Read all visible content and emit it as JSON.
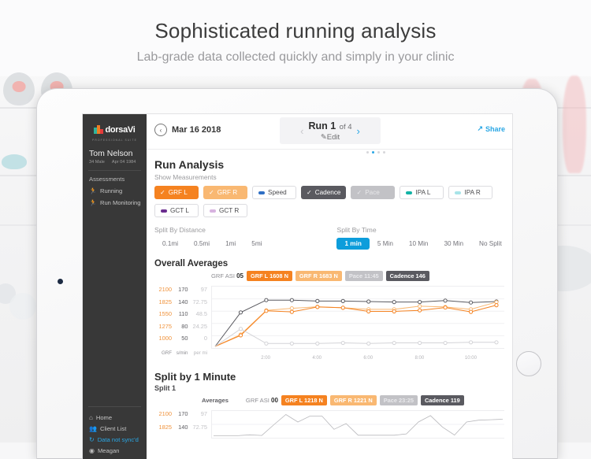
{
  "hero": {
    "title": "Sophisticated running analysis",
    "subtitle": "Lab-grade data collected quickly and simply in your clinic"
  },
  "sidebar": {
    "brand": "dorsaVi",
    "brand_sub": "PROFESSIONAL SUITE",
    "user_name": "Tom Nelson",
    "user_age_sex": "34 Male",
    "user_dob": "Apr 04 1984",
    "section_label": "Assessments",
    "items": [
      {
        "label": "Running",
        "icon": "runner-icon"
      },
      {
        "label": "Run Monitoring",
        "icon": "runner-icon"
      }
    ],
    "bottom_items": [
      {
        "label": "Home",
        "icon": "home-icon"
      },
      {
        "label": "Client List",
        "icon": "people-icon"
      },
      {
        "label": "Data not sync'd",
        "icon": "sync-icon"
      },
      {
        "label": "Meagan",
        "icon": "avatar-icon"
      }
    ]
  },
  "header": {
    "back_icon": "chevron-left-icon",
    "date": "Mar 16 2018",
    "prev_icon": "chevron-left-icon",
    "next_icon": "chevron-right-icon",
    "run_label": "Run 1",
    "run_of": "of 4",
    "edit_label": "Edit",
    "share_label": "Share",
    "share_icon": "share-icon",
    "pager_count": 4,
    "pager_active": 1
  },
  "main": {
    "title": "Run Analysis",
    "show_measurements_label": "Show Measurements",
    "measurements": [
      {
        "label": "GRF L",
        "style": "grfl",
        "checked": true,
        "swatch": ""
      },
      {
        "label": "GRF R",
        "style": "grfr",
        "checked": true,
        "swatch": ""
      },
      {
        "label": "Speed",
        "style": "out",
        "checked": false,
        "swatch": "#2f6fc4"
      },
      {
        "label": "Cadence",
        "style": "cad",
        "checked": true,
        "swatch": ""
      },
      {
        "label": "Pace",
        "style": "pace",
        "checked": true,
        "swatch": ""
      },
      {
        "label": "IPA L",
        "style": "out",
        "checked": false,
        "swatch": "#13b3a6"
      },
      {
        "label": "IPA R",
        "style": "out",
        "checked": false,
        "swatch": "#a8e4e8"
      },
      {
        "label": "GCT L",
        "style": "out",
        "checked": false,
        "swatch": "#6b2d8f"
      },
      {
        "label": "GCT R",
        "style": "out",
        "checked": false,
        "swatch": "#d7b3e0"
      }
    ],
    "split_by_distance_label": "Split By Distance",
    "split_distance_options": [
      "0.1mi",
      "0.5mi",
      "1mi",
      "5mi"
    ],
    "split_by_time_label": "Split By Time",
    "split_time_options": [
      "1 min",
      "5 Min",
      "10 Min",
      "30 Min",
      "No Split"
    ],
    "split_time_active": "1 min",
    "overall_averages_title": "Overall Averages",
    "overall_averages": {
      "asi_label": "GRF ASI",
      "asi_value": "05",
      "grf_l": "GRF L 1608 N",
      "grf_r": "GRF R 1683 N",
      "pace": "Pace 11:45",
      "cadence": "Cadence 146"
    },
    "split_title": "Split by 1 Minute",
    "split_subtitle": "Split 1",
    "split_averages_label": "Averages",
    "split_averages": {
      "asi_label": "GRF ASI",
      "asi_value": "00",
      "grf_l": "GRF L 1218 N",
      "grf_r": "GRF R 1221 N",
      "pace": "Pace 23:25",
      "cadence": "Cadence 119"
    }
  },
  "colors": {
    "accent_blue": "#0d9ddb",
    "grf_l": "#f58220",
    "grf_r": "#f9b872",
    "cadence": "#5a5a60",
    "pace": "#c2c2c6",
    "sidebar_bg": "#383838"
  },
  "chart_data": [
    {
      "type": "line",
      "title": "Overall Averages",
      "xlabel": "",
      "ylabel": "GRF / s/min / per mi",
      "grid": true,
      "legend": "none",
      "x": [
        0,
        1,
        2,
        3,
        4,
        5,
        6,
        7,
        8,
        9,
        10,
        10.5
      ],
      "xtick_labels": [
        "2:00",
        "4:00",
        "6:00",
        "8:00",
        "10:00"
      ],
      "xtick_positions": [
        2,
        4,
        6,
        8,
        10
      ],
      "y_axes": {
        "grf": {
          "ticks": [
            1000,
            1275,
            1550,
            1825,
            2100
          ],
          "color": "#f0923a",
          "unit": "GRF"
        },
        "smin": {
          "ticks": [
            50,
            80,
            110,
            140,
            170
          ],
          "color": "#5b5b60",
          "unit": "s/min"
        },
        "permi": {
          "ticks": [
            0,
            24.25,
            48.5,
            72.75,
            97
          ],
          "color": "#c3c3c7",
          "unit": "per mi"
        }
      },
      "series": [
        {
          "name": "Cadence",
          "color": "#5a5a60",
          "values": [
            50,
            122,
            148,
            148,
            146,
            146,
            145,
            144,
            144,
            147,
            143,
            145
          ]
        },
        {
          "name": "GRF R",
          "color": "#f9b872",
          "values": [
            1000,
            1230,
            1700,
            1740,
            1770,
            1750,
            1720,
            1720,
            1780,
            1765,
            1720,
            1860
          ]
        },
        {
          "name": "GRF L",
          "color": "#f58220",
          "values": [
            1000,
            1215,
            1690,
            1670,
            1765,
            1750,
            1680,
            1680,
            1700,
            1755,
            1670,
            1800
          ]
        },
        {
          "name": "Pace",
          "color": "#d3d3d7",
          "values": [
            0,
            30,
            5,
            5,
            5,
            6,
            5,
            6,
            6,
            6,
            7,
            7
          ]
        }
      ]
    },
    {
      "type": "line",
      "title": "Split by 1 Minute",
      "xlabel": "",
      "ylabel": "GRF / s/min / per mi",
      "grid": true,
      "legend": "none",
      "y_axes": {
        "grf": {
          "ticks": [
            1825,
            2100
          ],
          "color": "#f0923a",
          "unit": "GRF"
        },
        "smin": {
          "ticks": [
            140,
            170
          ],
          "color": "#5b5b60",
          "unit": "s/min"
        },
        "permi": {
          "ticks": [
            72.75,
            97
          ],
          "color": "#c3c3c7",
          "unit": "per mi"
        }
      },
      "series": [
        {
          "name": "Pace",
          "color": "#b8b8bc",
          "values": [
            2,
            2,
            2,
            6,
            3,
            50,
            95,
            62,
            88,
            88,
            30,
            55,
            4,
            4,
            4,
            4,
            10,
            62,
            90,
            40,
            5,
            62,
            70,
            72,
            74
          ]
        }
      ]
    }
  ]
}
